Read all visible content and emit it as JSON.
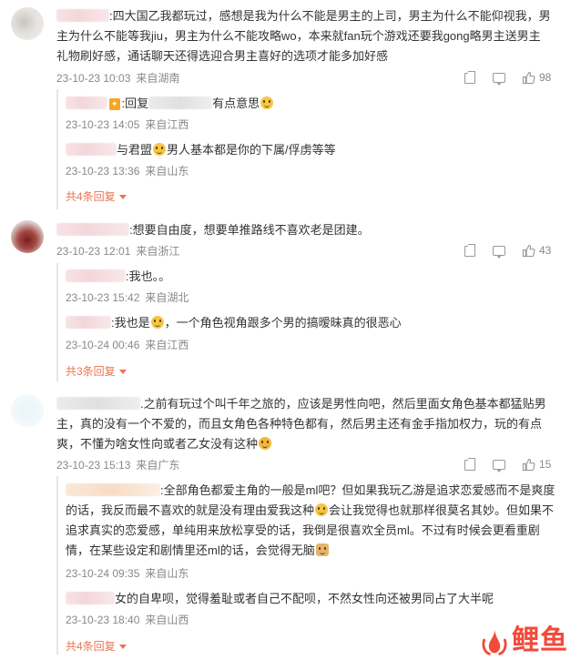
{
  "comments": [
    {
      "text_lines": [
        ":四大国乙我都玩过，感想是我为什么不能是男主的上司，男主为什么不能仰视我，男",
        "主为什么不能等我jiu，男主为什么不能攻略wo，本来就fan玩个游戏还要我gong略男主送男主",
        "礼物刷好感，通话聊天还得选迎合男主喜好的选项才能多加好感"
      ],
      "time": "23-10-23 10:03",
      "location": "来自湖南",
      "likes": "98",
      "replies": [
        {
          "text": ":回复",
          "text2": "有点意思",
          "time": "23-10-23 14:05",
          "location": "来自江西"
        },
        {
          "text": "与君盟",
          "text2": "男人基本都是你的下属/俘虏等等",
          "time": "23-10-23 13:36",
          "location": "来自山东"
        }
      ],
      "more_label": "共4条回复"
    },
    {
      "text_lines": [
        ":想要自由度，想要单推路线不喜欢老是团建。"
      ],
      "time": "23-10-23 12:01",
      "location": "来自浙江",
      "likes": "43",
      "replies": [
        {
          "text": ":我也。。",
          "time": "23-10-23 15:42",
          "location": "来自湖北"
        },
        {
          "text": ":我也是",
          "text2": "，一个角色视角跟多个男的搞暧昧真的很恶心",
          "time": "23-10-24 00:46",
          "location": "来自江西"
        }
      ],
      "more_label": "共3条回复"
    },
    {
      "text_lines": [
        ".之前有玩过个叫千年之旅的，应该是男性向吧，然后里面女角色基本都猛贴男",
        "主，真的没有一个不爱的，而且女角色各种特色都有，然后男主还有金手指加权力，玩的有点",
        "爽，不懂为啥女性向或者乙女没有这种"
      ],
      "time": "23-10-23 15:13",
      "location": "来自广东",
      "likes": "15",
      "replies": [
        {
          "lines": [
            ":全部角色都爱主角的一般是ml吧？但如果我玩乙游是追求恋爱感而不是爽度",
            "的话，我反而最不喜欢的就是没有理由爱我这种",
            "会让我觉得也就那样很莫名其妙。但如果不",
            "追求真实的恋爱感，单纯用来放松享受的话，我倒是很喜欢全员ml。不过有时候会更看重剧",
            "情，在某些设定和剧情里还ml的话，会觉得无脑"
          ],
          "time": "23-10-24 09:35",
          "location": "来自山东"
        },
        {
          "text": "女的自卑呗，觉得羞耻或者自己不配呗，不然女性向还被男同占了大半呢",
          "time": "23-10-23 18:40",
          "location": "来自山西"
        }
      ],
      "more_label": "共4条回复"
    }
  ],
  "watermark": {
    "text": "鲤鱼",
    "icon": "fire-icon"
  }
}
